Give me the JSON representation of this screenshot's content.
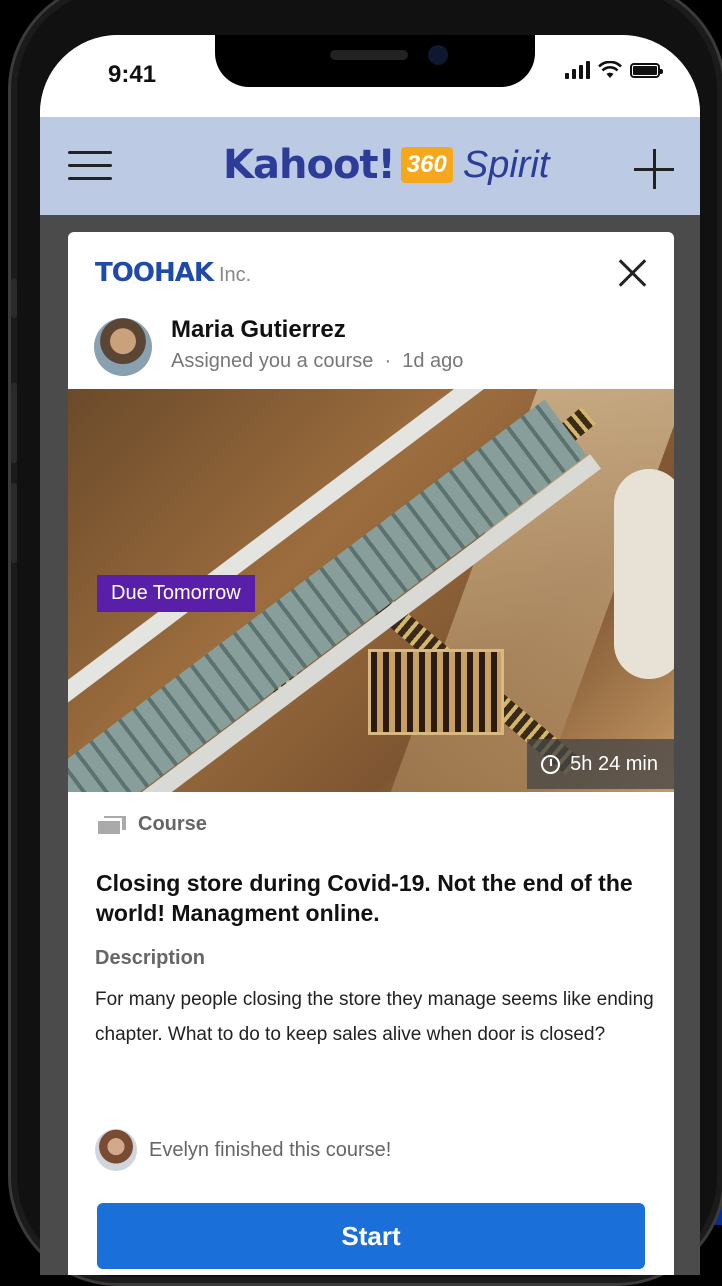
{
  "status_bar": {
    "time": "9:41"
  },
  "app_bar": {
    "logo_kahoot": "Kahoot!",
    "logo_badge": "360",
    "logo_product": "Spirit"
  },
  "card": {
    "company": {
      "logo": "TOOHAK",
      "suffix": "Inc."
    },
    "assigner": {
      "name": "Maria Gutierrez",
      "action": "Assigned you a course",
      "time_ago": "1d ago"
    },
    "due_badge": "Due Tomorrow",
    "duration": "5h 24 min",
    "type_label": "Course",
    "title": "Closing store during Covid-19. Not the end of the world! Managment online.",
    "description_label": "Description",
    "description": "For many people closing the store they manage seems like ending chapter. What to do to keep sales alive when door is closed?",
    "finisher_text": "Evelyn finished this course!",
    "start_label": "Start"
  },
  "icons": {
    "menu": "hamburger-menu-icon",
    "add": "plus-icon",
    "close": "close-icon",
    "clock": "clock-icon",
    "course": "course-icon"
  },
  "colors": {
    "app_bar": "#bccbe3",
    "brand": "#2d3c99",
    "badge_360": "#f6a81c",
    "due_badge": "#5a1fa8",
    "start_button": "#1a6fd8",
    "company_logo": "#1f4aa7"
  }
}
